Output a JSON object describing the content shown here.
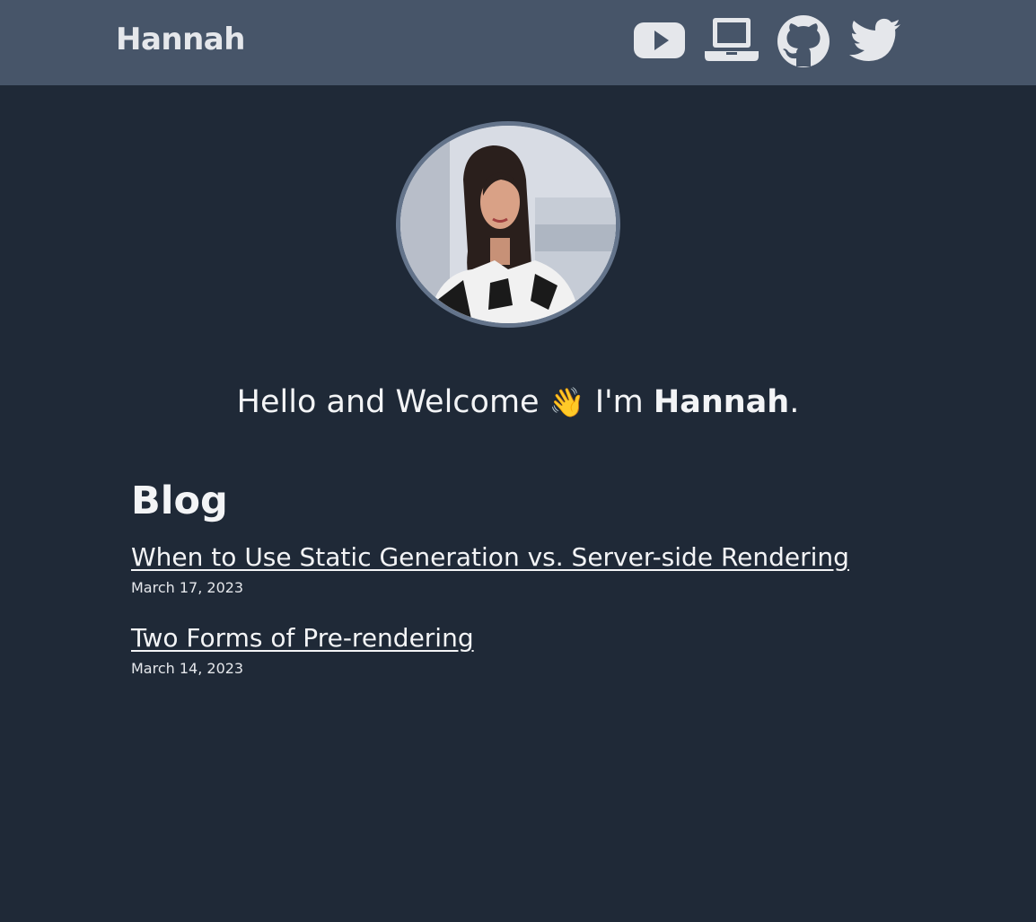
{
  "header": {
    "brand": "Hannah",
    "icons": [
      {
        "name": "youtube-icon"
      },
      {
        "name": "laptop-icon"
      },
      {
        "name": "github-icon"
      },
      {
        "name": "twitter-icon"
      }
    ]
  },
  "hero": {
    "greeting_prefix": "Hello and Welcome",
    "wave_emoji": "👋",
    "intro": "I'm",
    "name": "Hannah",
    "suffix": "."
  },
  "blog": {
    "title": "Blog",
    "posts": [
      {
        "title": "When to Use Static Generation vs. Server-side Rendering",
        "date": "March 17, 2023"
      },
      {
        "title": "Two Forms of Pre-rendering",
        "date": "March 14, 2023"
      }
    ]
  },
  "colors": {
    "background": "#1f2937",
    "navbar": "#475569",
    "text": "#f3f4f6",
    "avatar_border": "#64748b"
  }
}
